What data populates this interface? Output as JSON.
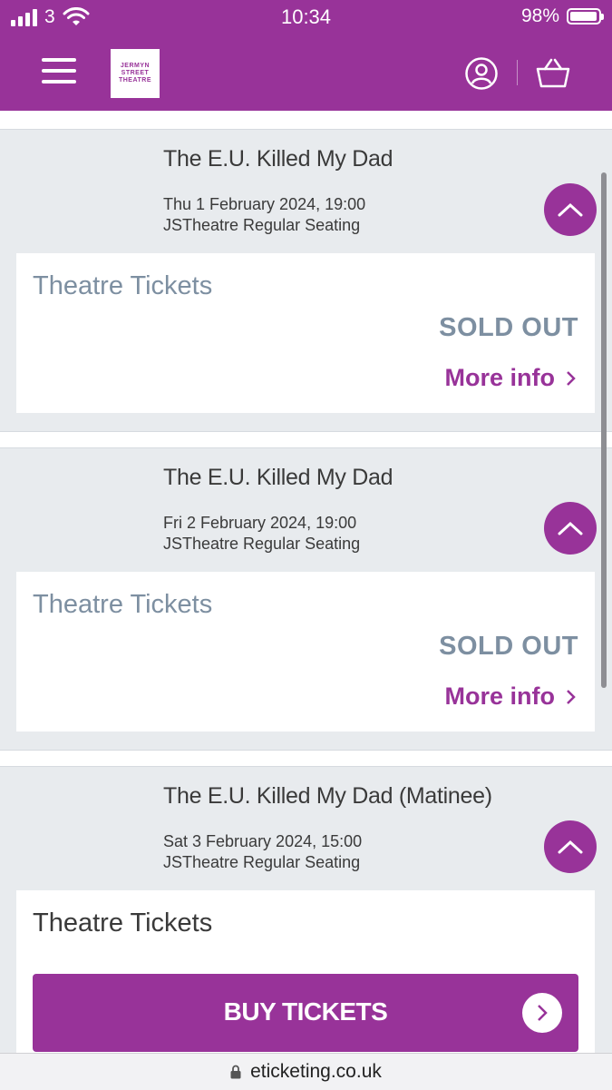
{
  "status_bar": {
    "carrier": "3",
    "time": "10:34",
    "battery": "98%"
  },
  "header": {
    "logo_text": [
      "JERMYN",
      "STREET",
      "THEATRE"
    ],
    "menu_icon": "hamburger-icon",
    "account_icon": "user-circle-icon",
    "basket_icon": "basket-icon"
  },
  "colors": {
    "brand": "#983399",
    "sold_out": "#7d8fa1",
    "panel_bg": "#e8ebee"
  },
  "performances": [
    {
      "title": "The E.U. Killed My Dad",
      "date": "Thu 1 February 2024, 19:00",
      "seating": "JSTheatre Regular Seating",
      "ticket_type": "Theatre Tickets",
      "status": "SOLD OUT",
      "more_info": "More info"
    },
    {
      "title": "The E.U. Killed My Dad",
      "date": "Fri 2 February 2024, 19:00",
      "seating": "JSTheatre Regular Seating",
      "ticket_type": "Theatre Tickets",
      "status": "SOLD OUT",
      "more_info": "More info"
    },
    {
      "title": "The E.U. Killed My Dad (Matinee)",
      "date": "Sat 3 February 2024, 15:00",
      "seating": "JSTheatre Regular Seating",
      "ticket_type": "Theatre Tickets",
      "buy_label": "BUY TICKETS"
    }
  ],
  "url_bar": {
    "url": "eticketing.co.uk"
  }
}
